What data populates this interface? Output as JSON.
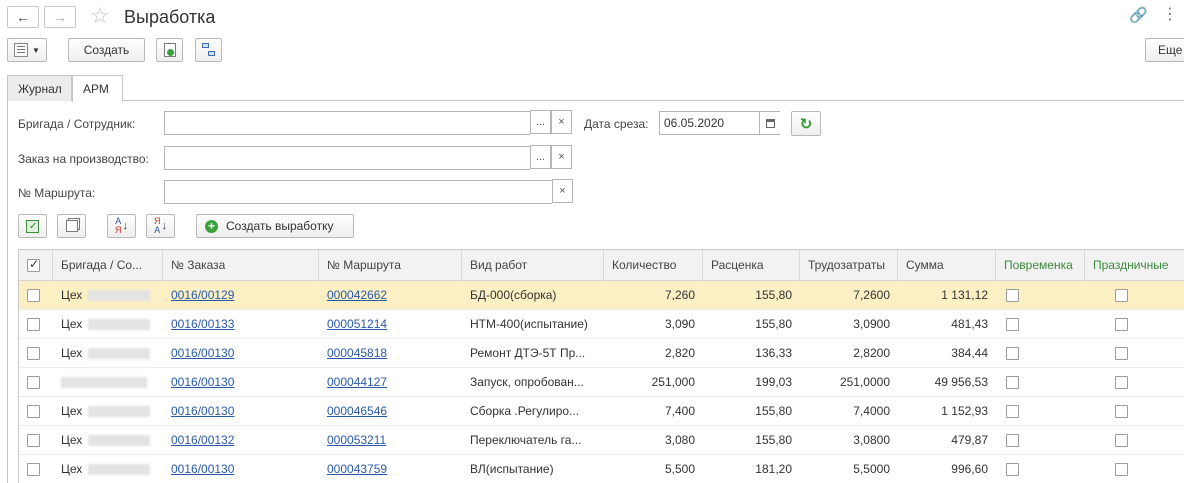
{
  "window": {
    "title": "Выработка"
  },
  "toolbar": {
    "create_label": "Создать",
    "more_label": "Еще"
  },
  "tabs": [
    {
      "label": "Журнал",
      "active": false
    },
    {
      "label": "АРМ",
      "active": true
    }
  ],
  "filters": {
    "brigade_label": "Бригада / Сотрудник:",
    "order_label": "Заказ на производство:",
    "route_label": "№ Маршрута:",
    "date_label": "Дата среза:",
    "date_value": "06.05.2020",
    "select_glyph": "...",
    "clear_glyph": "×"
  },
  "actions": {
    "create_output_label": "Создать выработку"
  },
  "table": {
    "columns": [
      "Бригада / Со...",
      "№ Заказа",
      "№ Маршрута",
      "Вид работ",
      "Количество",
      "Расценка",
      "Трудозатраты",
      "Сумма",
      "Повременка",
      "Праздничные"
    ],
    "rows": [
      {
        "brigade": "Цех",
        "order": "0016/00129",
        "route": "000042662",
        "work": "БД-000(сборка)",
        "qty": "7,260",
        "rate": "155,80",
        "labor": "7,2600",
        "sum": "1 131,12"
      },
      {
        "brigade": "Цех",
        "order": "0016/00133",
        "route": "000051214",
        "work": "НТМ-400(испытание)",
        "qty": "3,090",
        "rate": "155,80",
        "labor": "3,0900",
        "sum": "481,43"
      },
      {
        "brigade": "Цех",
        "order": "0016/00130",
        "route": "000045818",
        "work": "Ремонт ДТЭ-5Т Пр...",
        "qty": "2,820",
        "rate": "136,33",
        "labor": "2,8200",
        "sum": "384,44"
      },
      {
        "brigade": "",
        "order": "0016/00130",
        "route": "000044127",
        "work": "Запуск, опробован...",
        "qty": "251,000",
        "rate": "199,03",
        "labor": "251,0000",
        "sum": "49 956,53"
      },
      {
        "brigade": "Цех",
        "order": "0016/00130",
        "route": "000046546",
        "work": "Сборка .Регулиро...",
        "qty": "7,400",
        "rate": "155,80",
        "labor": "7,4000",
        "sum": "1 152,93"
      },
      {
        "brigade": "Цех",
        "order": "0016/00132",
        "route": "000053211",
        "work": "Переключатель га...",
        "qty": "3,080",
        "rate": "155,80",
        "labor": "3,0800",
        "sum": "479,87"
      },
      {
        "brigade": "Цех",
        "order": "0016/00130",
        "route": "000043759",
        "work": "ВЛ(испытание)",
        "qty": "5,500",
        "rate": "181,20",
        "labor": "5,5000",
        "sum": "996,60"
      }
    ]
  }
}
